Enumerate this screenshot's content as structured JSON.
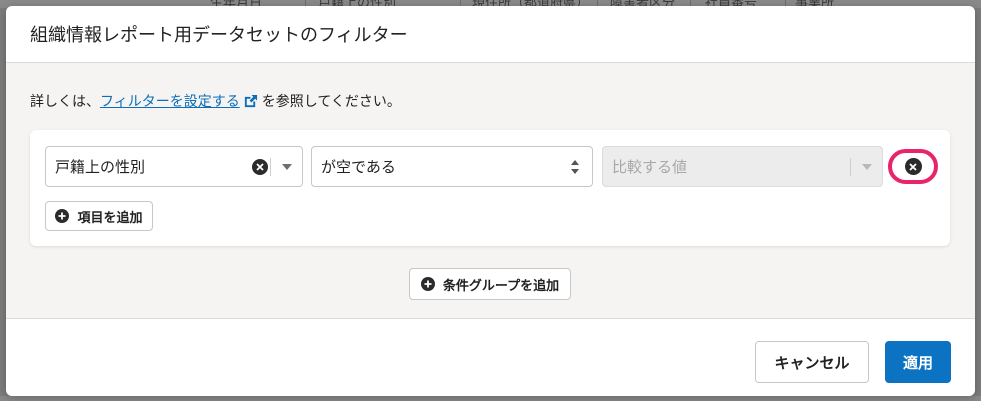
{
  "background_table": {
    "columns": [
      "生年月日",
      "戸籍上の性別",
      "現住所（都道府県）",
      "障害者区分",
      "社員番号",
      "事業所"
    ]
  },
  "modal": {
    "title": "組織情報レポート用データセットのフィルター",
    "help_prefix": "詳しくは、",
    "help_link": "フィルターを設定する",
    "help_suffix": "を参照してください。",
    "condition": {
      "field_value": "戸籍上の性別",
      "operator_value": "が空である",
      "compare_placeholder": "比較する値"
    },
    "add_item_label": "項目を追加",
    "add_group_label": "条件グループを追加",
    "cancel_label": "キャンセル",
    "apply_label": "適用"
  },
  "colors": {
    "link": "#0b6fb8",
    "primary": "#0b73c2",
    "highlight": "#e8246a"
  }
}
